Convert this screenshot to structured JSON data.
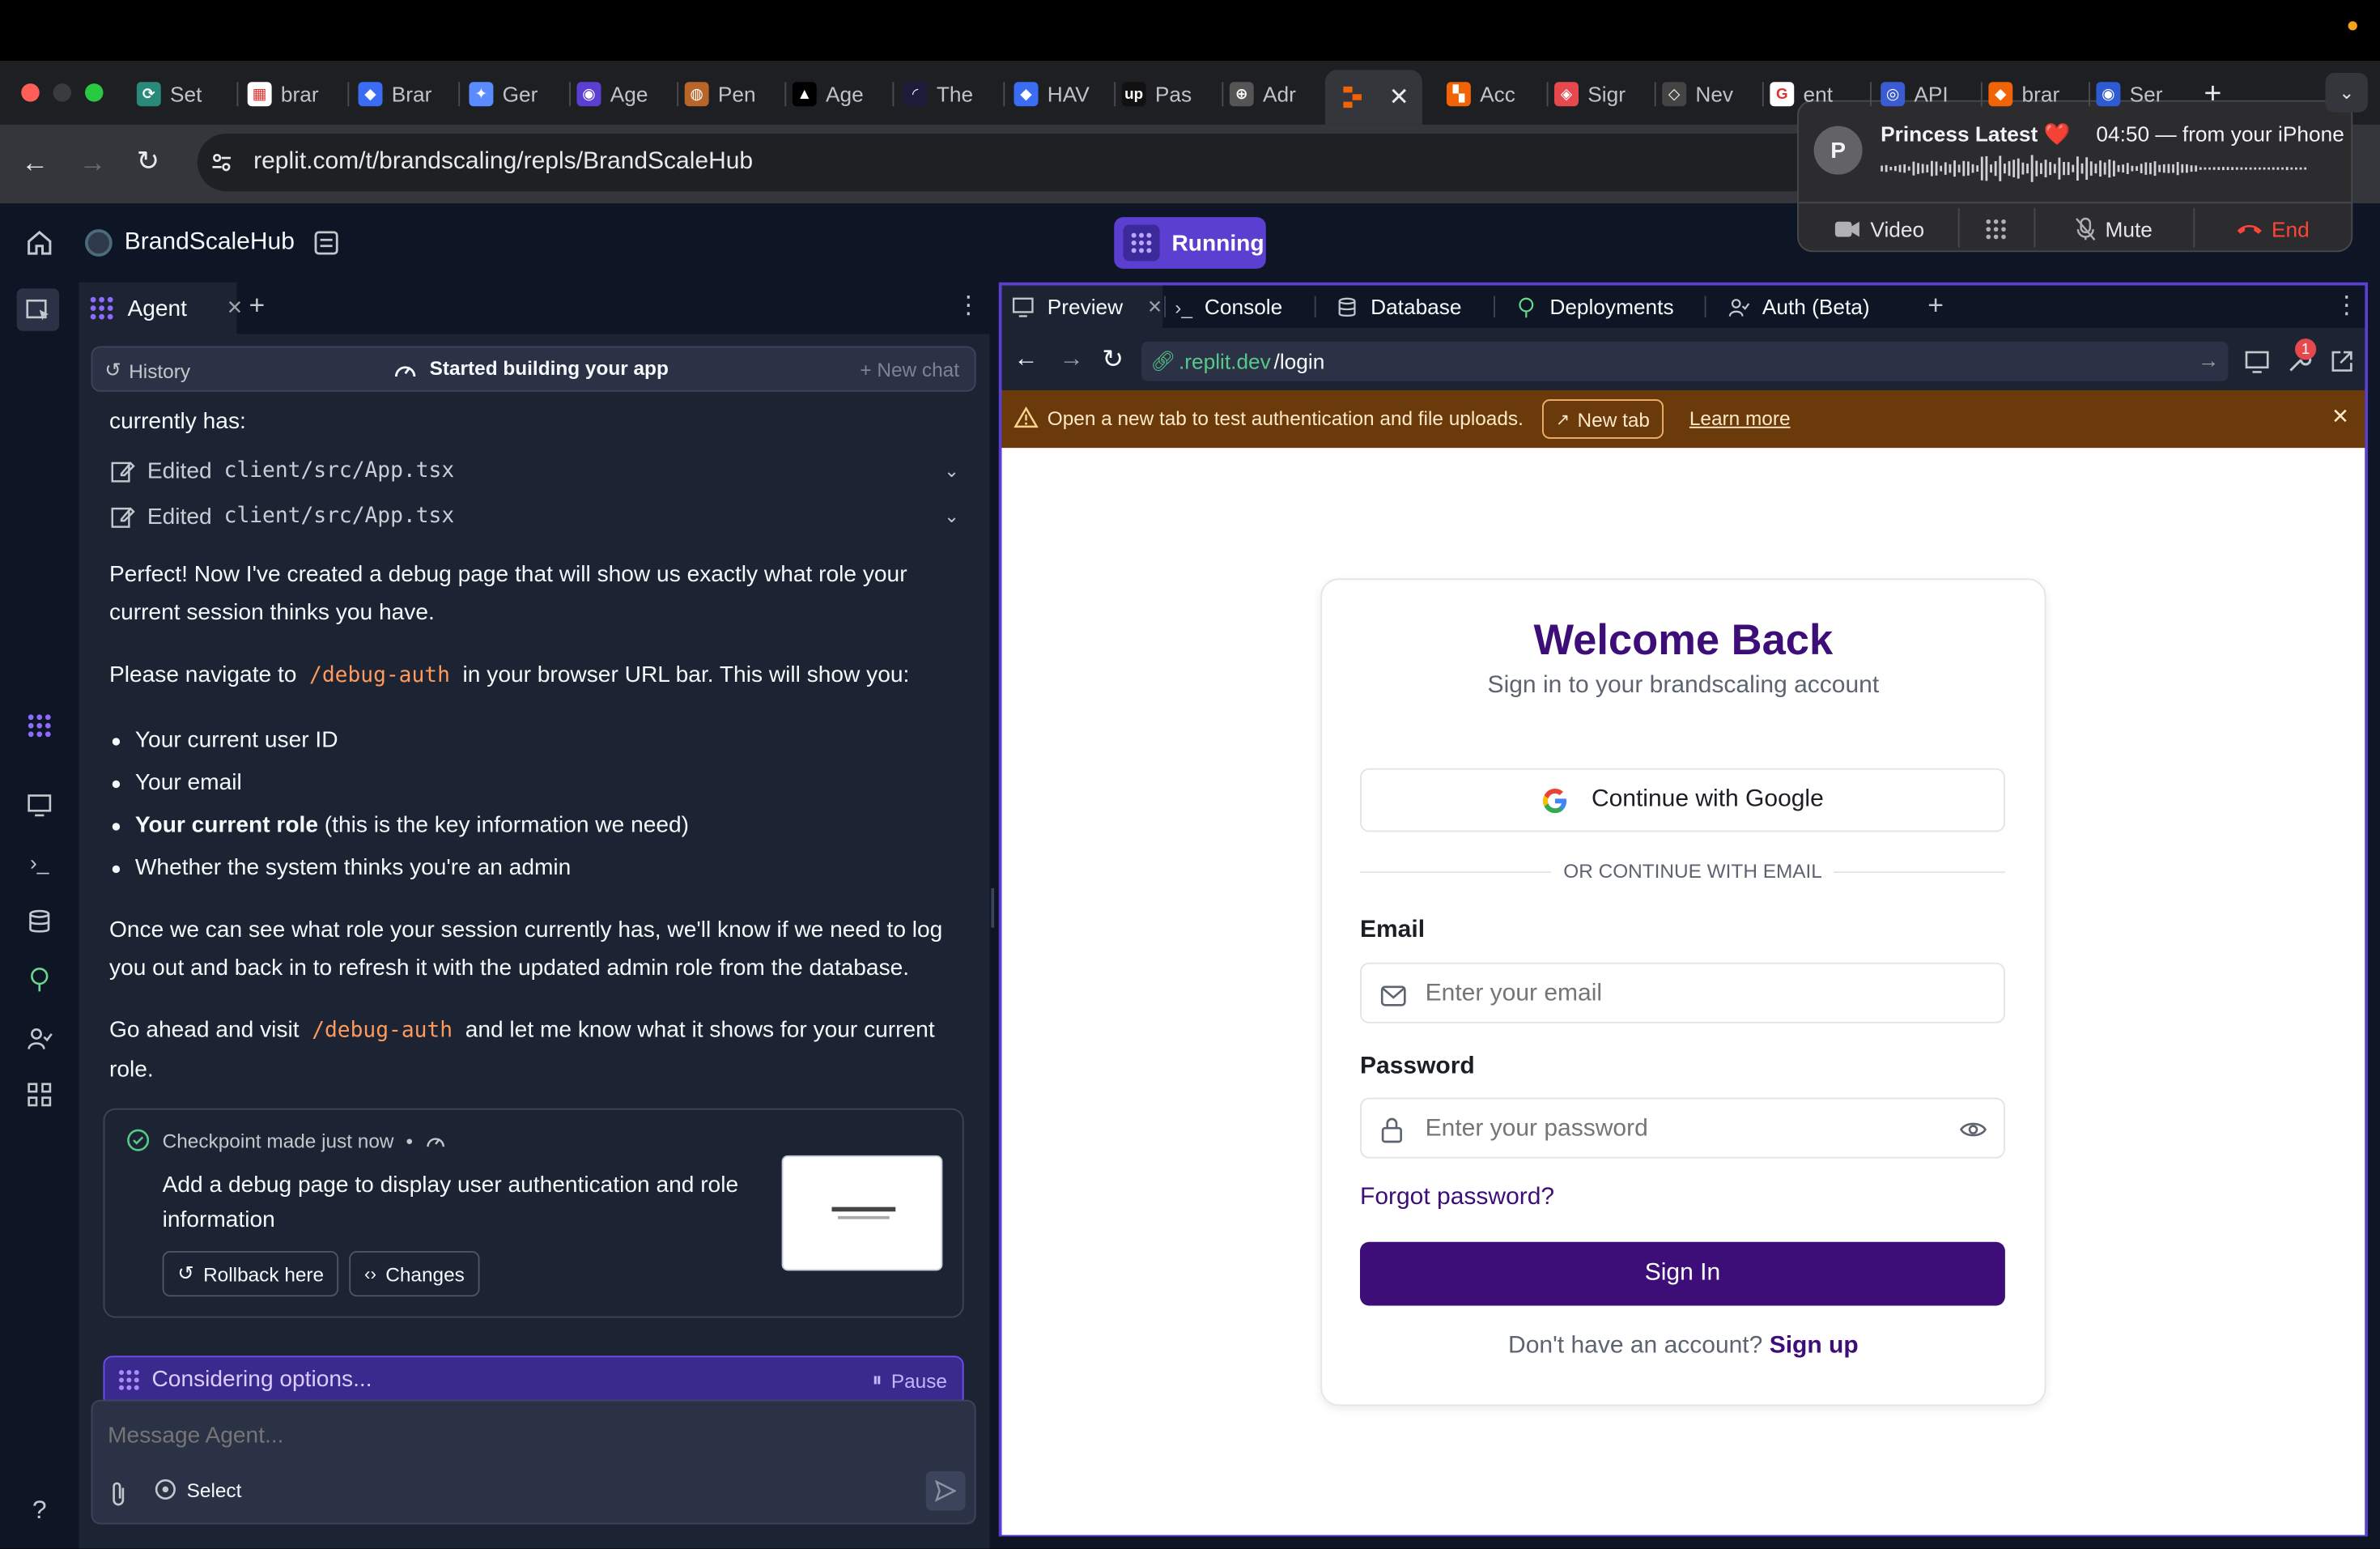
{
  "browser": {
    "tabs": [
      "Set",
      "brar",
      "Brar",
      "Ger",
      "Age",
      "Pen",
      "Age",
      "The",
      "HAV",
      "Pas",
      "Adr",
      "",
      "Acc",
      "Sigr",
      "Nev",
      "ent",
      "API",
      "brar",
      "Ser"
    ],
    "url": "replit.com/t/brandscaling/repls/BrandScaleHub"
  },
  "call": {
    "caller_initial": "P",
    "caller_name": "Princess Latest",
    "heart": "❤️",
    "status": "04:50 — from your iPhone",
    "video_label": "Video",
    "mute_label": "Mute",
    "end_label": "End"
  },
  "replit": {
    "project_name": "BrandScaleHub",
    "run_label": "Running"
  },
  "agent": {
    "tab_label": "Agent",
    "history_label": "History",
    "session_title": "Started building your app",
    "new_chat_label": "+ New chat",
    "cut_text": "currently has:",
    "edits": [
      {
        "action": "Edited",
        "file": "client/src/App.tsx"
      },
      {
        "action": "Edited",
        "file": "client/src/App.tsx"
      }
    ],
    "para1": "Perfect! Now I've created a debug page that will show us exactly what role your current session thinks you have.",
    "para2_before": "Please navigate to",
    "para2_code": "/debug-auth",
    "para2_after": "in your browser URL bar. This will show you:",
    "bullets": [
      {
        "bold": "",
        "text": "Your current user ID"
      },
      {
        "bold": "",
        "text": "Your email"
      },
      {
        "bold": "Your current role",
        "text": " (this is the key information we need)"
      },
      {
        "bold": "",
        "text": "Whether the system thinks you're an admin"
      }
    ],
    "para3": "Once we can see what role your session currently has, we'll know if we need to log you out and back in to refresh it with the updated admin role from the database.",
    "para4_before": "Go ahead and visit",
    "para4_code": "/debug-auth",
    "para4_after": "and let me know what it shows for your current role.",
    "checkpoint": {
      "label": "Checkpoint made just now",
      "dot": "•",
      "description": "Add a debug page to display user authentication and role information",
      "rollback_label": "Rollback here",
      "changes_label": "Changes"
    },
    "status_label": "Considering options...",
    "pause_label": "Pause",
    "message_placeholder": "Message Agent...",
    "select_label": "Select"
  },
  "panel_tabs": {
    "preview": "Preview",
    "console": "Console",
    "database": "Database",
    "deployments": "Deployments",
    "auth": "Auth (Beta)"
  },
  "preview": {
    "url_domain": ".replit.dev",
    "url_path": "/login",
    "notification_count": "1",
    "warning_text": "Open a new tab to test authentication and file uploads.",
    "new_tab_label": "New tab",
    "learn_more_label": "Learn more"
  },
  "login": {
    "title": "Welcome Back",
    "subtitle": "Sign in to your brandscaling account",
    "google_label": "Continue with Google",
    "divider_text": "OR CONTINUE WITH EMAIL",
    "email_label": "Email",
    "email_placeholder": "Enter your email",
    "password_label": "Password",
    "password_placeholder": "Enter your password",
    "forgot_label": "Forgot password?",
    "signin_label": "Sign In",
    "no_account_text": "Don't have an account?",
    "signup_label": "Sign up"
  },
  "colors": {
    "brand_purple": "#3d0e78",
    "replit_accent": "#5b3fd1",
    "warning_bg": "#6b3a0a",
    "code_orange": "#ff9a5a",
    "end_red": "#ff453a"
  }
}
